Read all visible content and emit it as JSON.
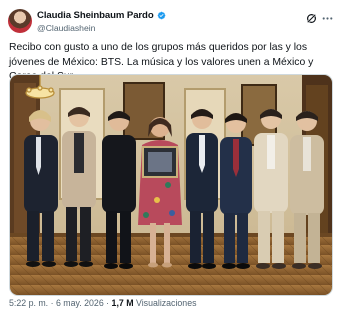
{
  "author": {
    "name": "Claudia Sheinbaum Pardo",
    "handle": "@Claudiashein",
    "avatar_icon": "profile-photo",
    "verified_icon": "verified-badge-icon",
    "verified_color": "#1d9bf0"
  },
  "header_actions": {
    "grok_icon": "grok-icon",
    "more_icon": "more-options-icon"
  },
  "tweet": {
    "text": "Recibo con gusto a uno de los grupos más queridos por las y los jóvenes de México: BTS. La música y los valores unen a México y Corea del Sur."
  },
  "media": {
    "type": "photo",
    "people_count": 8,
    "held_item": "framed-picture"
  },
  "meta": {
    "time": "5:22 p. m.",
    "separator": " · ",
    "date": "6 may. 2026",
    "views_count": "1,7 M",
    "views_label": "Visualizaciones"
  },
  "colors": {
    "text_primary": "#0f1419",
    "text_secondary": "#536471",
    "border": "#cfd9de"
  }
}
